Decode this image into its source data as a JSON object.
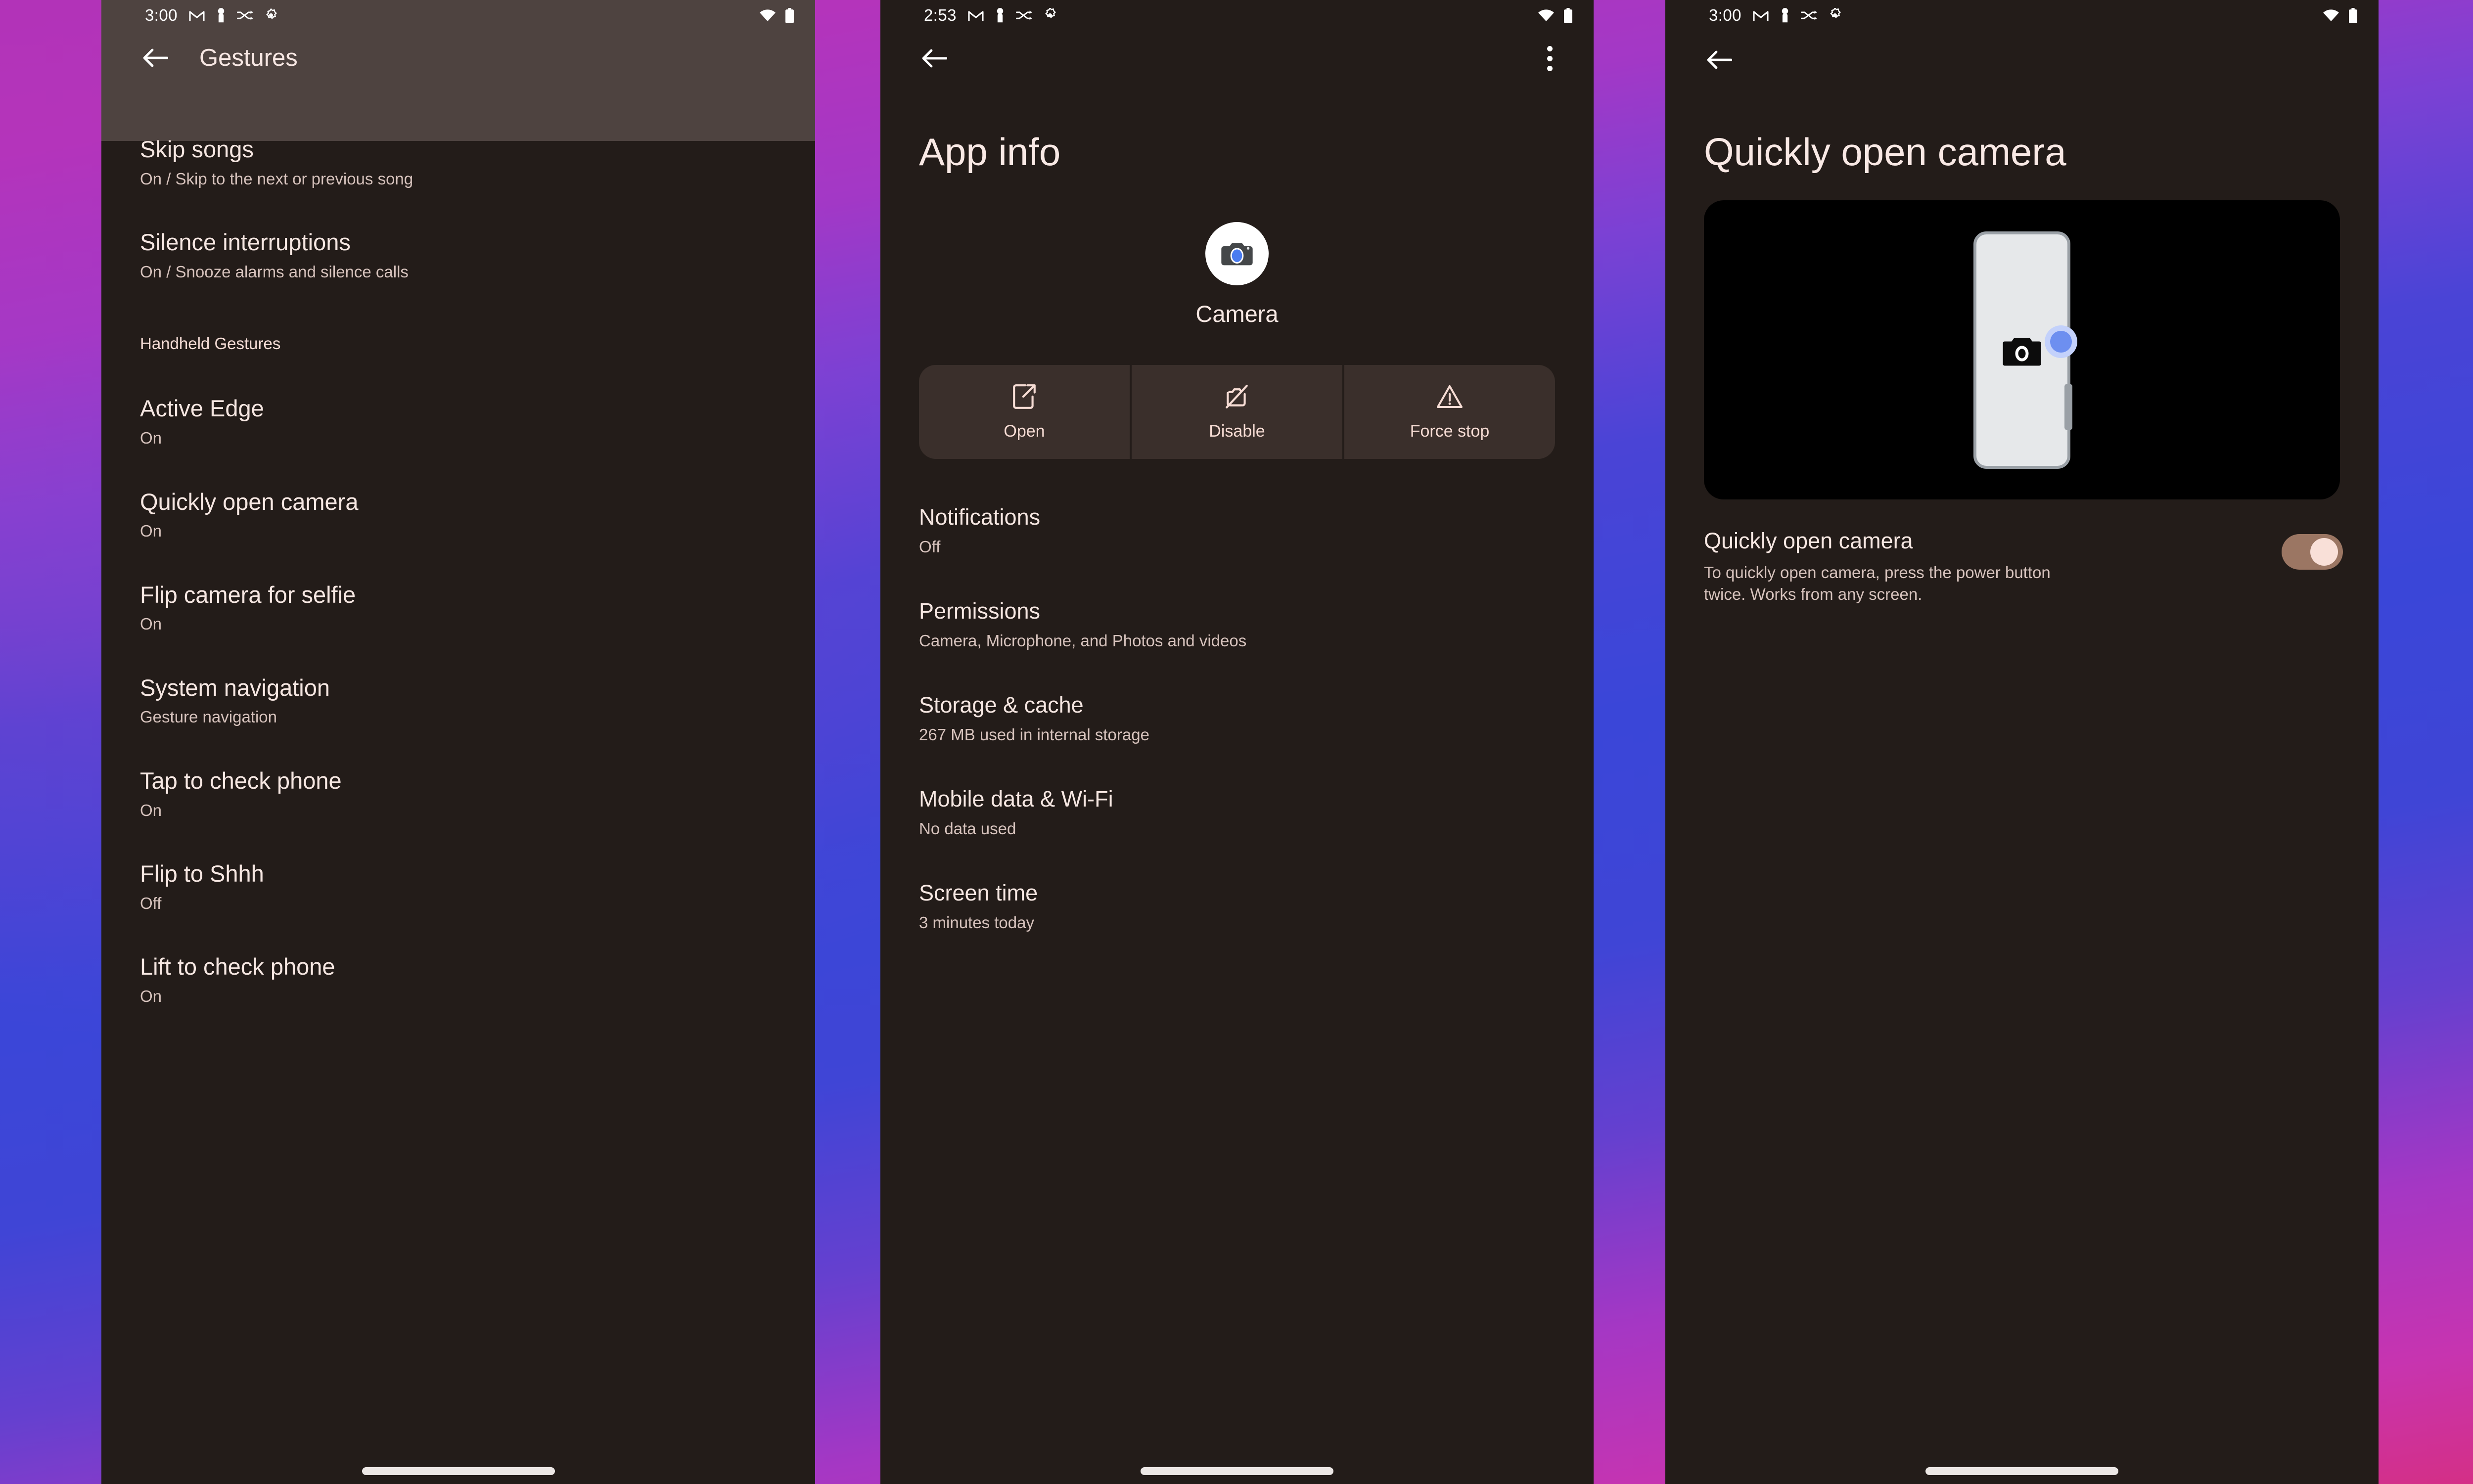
{
  "wallpaper": {
    "colors": [
      "#b233b8",
      "#3a46d8",
      "#d42f86"
    ]
  },
  "theme": {
    "panel_bg": "#231c19",
    "appbar_tinted_bg": "#4e4340",
    "title_color": "#f6e7e2",
    "subtitle_color": "#d6c2bc",
    "action_btn_bg": "#3a2f2b",
    "switch_on_track": "#9b7663",
    "switch_on_knob": "#f9e0d8"
  },
  "panel1": {
    "status_bar": {
      "time": "3:00",
      "left_icons": [
        "gmail-icon",
        "pawn-icon",
        "shuffle-icon",
        "gear-icon"
      ],
      "right_icons": [
        "wifi-icon",
        "battery-icon"
      ]
    },
    "appbar": {
      "back": "back-arrow-icon",
      "title": "Gestures"
    },
    "items": [
      {
        "title": "Skip songs",
        "sub": "On / Skip to the next or previous song"
      },
      {
        "title": "Silence interruptions",
        "sub": "On / Snooze alarms and silence calls"
      }
    ],
    "section_header": "Handheld Gestures",
    "handheld_items": [
      {
        "title": "Active Edge",
        "sub": "On"
      },
      {
        "title": "Quickly open camera",
        "sub": "On"
      },
      {
        "title": "Flip camera for selfie",
        "sub": "On"
      },
      {
        "title": "System navigation",
        "sub": "Gesture navigation"
      },
      {
        "title": "Tap to check phone",
        "sub": "On"
      },
      {
        "title": "Flip to Shhh",
        "sub": "Off"
      },
      {
        "title": "Lift to check phone",
        "sub": "On"
      }
    ]
  },
  "panel2": {
    "status_bar": {
      "time": "2:53",
      "left_icons": [
        "gmail-icon",
        "pawn-icon",
        "shuffle-icon",
        "gear-icon"
      ],
      "right_icons": [
        "wifi-icon",
        "battery-icon"
      ]
    },
    "appbar": {
      "back": "back-arrow-icon",
      "overflow": "overflow-menu-icon"
    },
    "title": "App info",
    "app": {
      "icon": "camera-app-icon",
      "name": "Camera"
    },
    "actions": [
      {
        "icon": "open-in-new-icon",
        "label": "Open"
      },
      {
        "icon": "disable-icon",
        "label": "Disable"
      },
      {
        "icon": "warning-icon",
        "label": "Force stop"
      }
    ],
    "items": [
      {
        "title": "Notifications",
        "sub": "Off"
      },
      {
        "title": "Permissions",
        "sub": "Camera, Microphone, and Photos and videos"
      },
      {
        "title": "Storage & cache",
        "sub": "267 MB used in internal storage"
      },
      {
        "title": "Mobile data & Wi-Fi",
        "sub": "No data used"
      },
      {
        "title": "Screen time",
        "sub": "3 minutes today"
      }
    ]
  },
  "panel3": {
    "status_bar": {
      "time": "3:00",
      "left_icons": [
        "gmail-icon",
        "pawn-icon",
        "shuffle-icon",
        "gear-icon"
      ],
      "right_icons": [
        "wifi-icon",
        "battery-icon"
      ]
    },
    "appbar": {
      "back": "back-arrow-icon"
    },
    "title": "Quickly open camera",
    "illustration": {
      "phone": "phone-illustration",
      "camera_glyph": "camera-icon",
      "power_button": "power-button-highlight",
      "volume_button": "volume-button"
    },
    "toggle": {
      "title": "Quickly open camera",
      "sub": "To quickly open camera, press the power button twice. Works from any screen.",
      "state": "On"
    }
  }
}
